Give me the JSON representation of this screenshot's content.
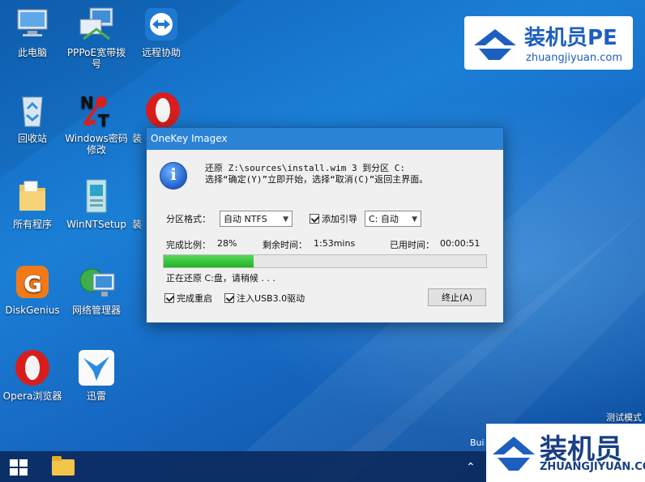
{
  "desktop": {
    "icons": [
      {
        "label": "此电脑"
      },
      {
        "label": "PPPoE宽带拨号"
      },
      {
        "label": "远程协助"
      },
      {
        "label": "回收站"
      },
      {
        "label": "Windows密码修改"
      },
      {
        "label": "装"
      },
      {
        "label": "所有程序"
      },
      {
        "label": "WinNTSetup"
      },
      {
        "label": "装"
      },
      {
        "label": "DiskGenius"
      },
      {
        "label": "网络管理器"
      },
      {
        "label": "Opera浏览器"
      },
      {
        "label": "迅雷"
      }
    ]
  },
  "dialog": {
    "title": "OneKey Imagex",
    "message_line1": "还原 Z:\\sources\\install.wim 3 到分区 C:",
    "message_line2": "选择“确定(Y)”立即开始，选择“取消(C)”返回主界面。",
    "partition_format_label": "分区格式：",
    "partition_format_value": "自动 NTFS",
    "add_boot_label": "添加引导",
    "boot_target_value": "C: 自动",
    "completion_label": "完成比例：",
    "completion_value": "28%",
    "progress_fraction": 0.28,
    "remaining_label": "剩余时间：",
    "remaining_value": "1:53mins",
    "elapsed_label": "已用时间：",
    "elapsed_value": "00:00:51",
    "status_text": "正在还原 C:盘，请稍候 . . .",
    "reboot_label": "完成重启",
    "usb3_label": "注入USB3.0驱动",
    "stop_button": "终止(A)"
  },
  "watermark": {
    "top_title": "装机员PE",
    "top_url": "zhuangjiyuan.com",
    "bottom_title": "装机员",
    "bottom_url": "ZHUANGJIYUAN.COM"
  },
  "system": {
    "test_mode": "测试模式",
    "build_prefix": "Bui"
  },
  "colors": {
    "accent": "#2b83d6",
    "progress": "#23b326",
    "brand": "#1d5fbf"
  }
}
